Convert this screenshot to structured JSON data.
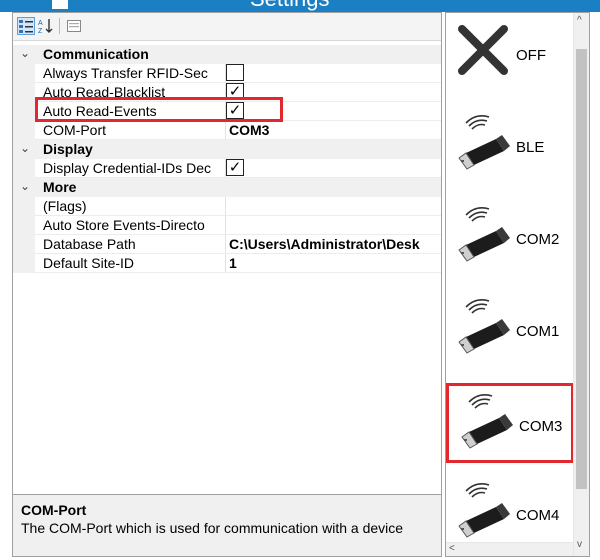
{
  "window": {
    "title": "Settings"
  },
  "toolbar": {
    "buttons": [
      {
        "name": "categorized-view",
        "icon": "categorized-icon"
      },
      {
        "name": "alphabetical-sort",
        "icon": "sort-az-icon"
      },
      {
        "name": "property-pages",
        "icon": "property-pages-icon"
      }
    ]
  },
  "grid": {
    "categories": [
      {
        "label": "Communication",
        "properties": [
          {
            "name": "Always Transfer RFID-Sec",
            "type": "checkbox",
            "checked": false
          },
          {
            "name": "Auto Read-Blacklist",
            "type": "checkbox",
            "checked": true
          },
          {
            "name": "Auto Read-Events",
            "type": "checkbox",
            "checked": true
          },
          {
            "name": "COM-Port",
            "type": "text",
            "value": "COM3"
          }
        ]
      },
      {
        "label": "Display",
        "properties": [
          {
            "name": "Display Credential-IDs Dec",
            "type": "checkbox",
            "checked": true
          }
        ]
      },
      {
        "label": "More",
        "properties": [
          {
            "name": "(Flags)",
            "type": "text",
            "value": ""
          },
          {
            "name": "Auto Store Events-Directo",
            "type": "text",
            "value": ""
          },
          {
            "name": "Database Path",
            "type": "text",
            "value": "C:\\Users\\Administrator\\Desk"
          },
          {
            "name": "Default Site-ID",
            "type": "text",
            "value": "1"
          }
        ]
      }
    ],
    "check_mark": "✓",
    "caret": "⌄",
    "selected_property": "COM-Port"
  },
  "help": {
    "title": "COM-Port",
    "description": "The COM-Port which is used for communication with a device"
  },
  "ports": {
    "items": [
      {
        "label": "OFF",
        "icon": "off-x-icon",
        "selected": false
      },
      {
        "label": "BLE",
        "icon": "usb-wireless-dongle-icon",
        "selected": false
      },
      {
        "label": "COM2",
        "icon": "usb-wireless-dongle-icon",
        "selected": false
      },
      {
        "label": "COM1",
        "icon": "usb-wireless-dongle-icon",
        "selected": false
      },
      {
        "label": "COM3",
        "icon": "usb-wireless-dongle-icon",
        "selected": true
      },
      {
        "label": "COM4",
        "icon": "usb-wireless-dongle-icon",
        "selected": false
      }
    ]
  },
  "colors": {
    "highlight": "#e0282e",
    "titlebar": "#1b7fc4",
    "category_bg": "#f0f0f0"
  }
}
